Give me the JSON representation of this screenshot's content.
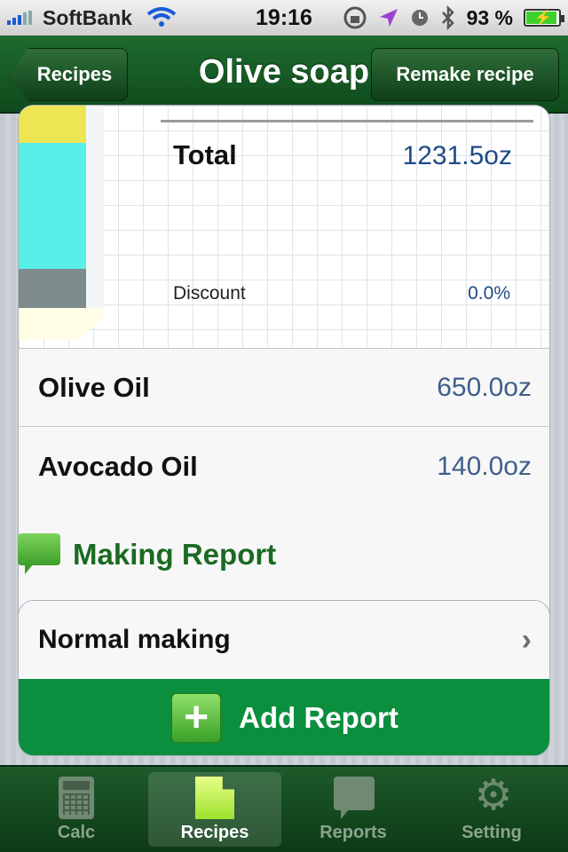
{
  "status_bar": {
    "carrier": "SoftBank",
    "time": "19:16",
    "battery": "93 %"
  },
  "nav": {
    "back_label": "Recipes",
    "title": "Olive soap",
    "action_label": "Remake recipe"
  },
  "summary": {
    "total_label": "Total",
    "total_value": "1231.5oz",
    "discount_label": "Discount",
    "discount_value": "0.0%"
  },
  "ingredients": [
    {
      "name": "Olive Oil",
      "amount": "650.0oz"
    },
    {
      "name": "Avocado Oil",
      "amount": "140.0oz"
    }
  ],
  "report_section": {
    "title": "Making Report",
    "item_label": "Normal making",
    "add_label": "Add Report"
  },
  "tabs": [
    {
      "label": "Calc"
    },
    {
      "label": "Recipes"
    },
    {
      "label": "Reports"
    },
    {
      "label": "Setting"
    }
  ],
  "colors": {
    "nav_green": "#1f6b2f",
    "add_button_green": "#0b8e3d",
    "section_title_green": "#1b6a22",
    "value_blue": "#1f4a85"
  }
}
